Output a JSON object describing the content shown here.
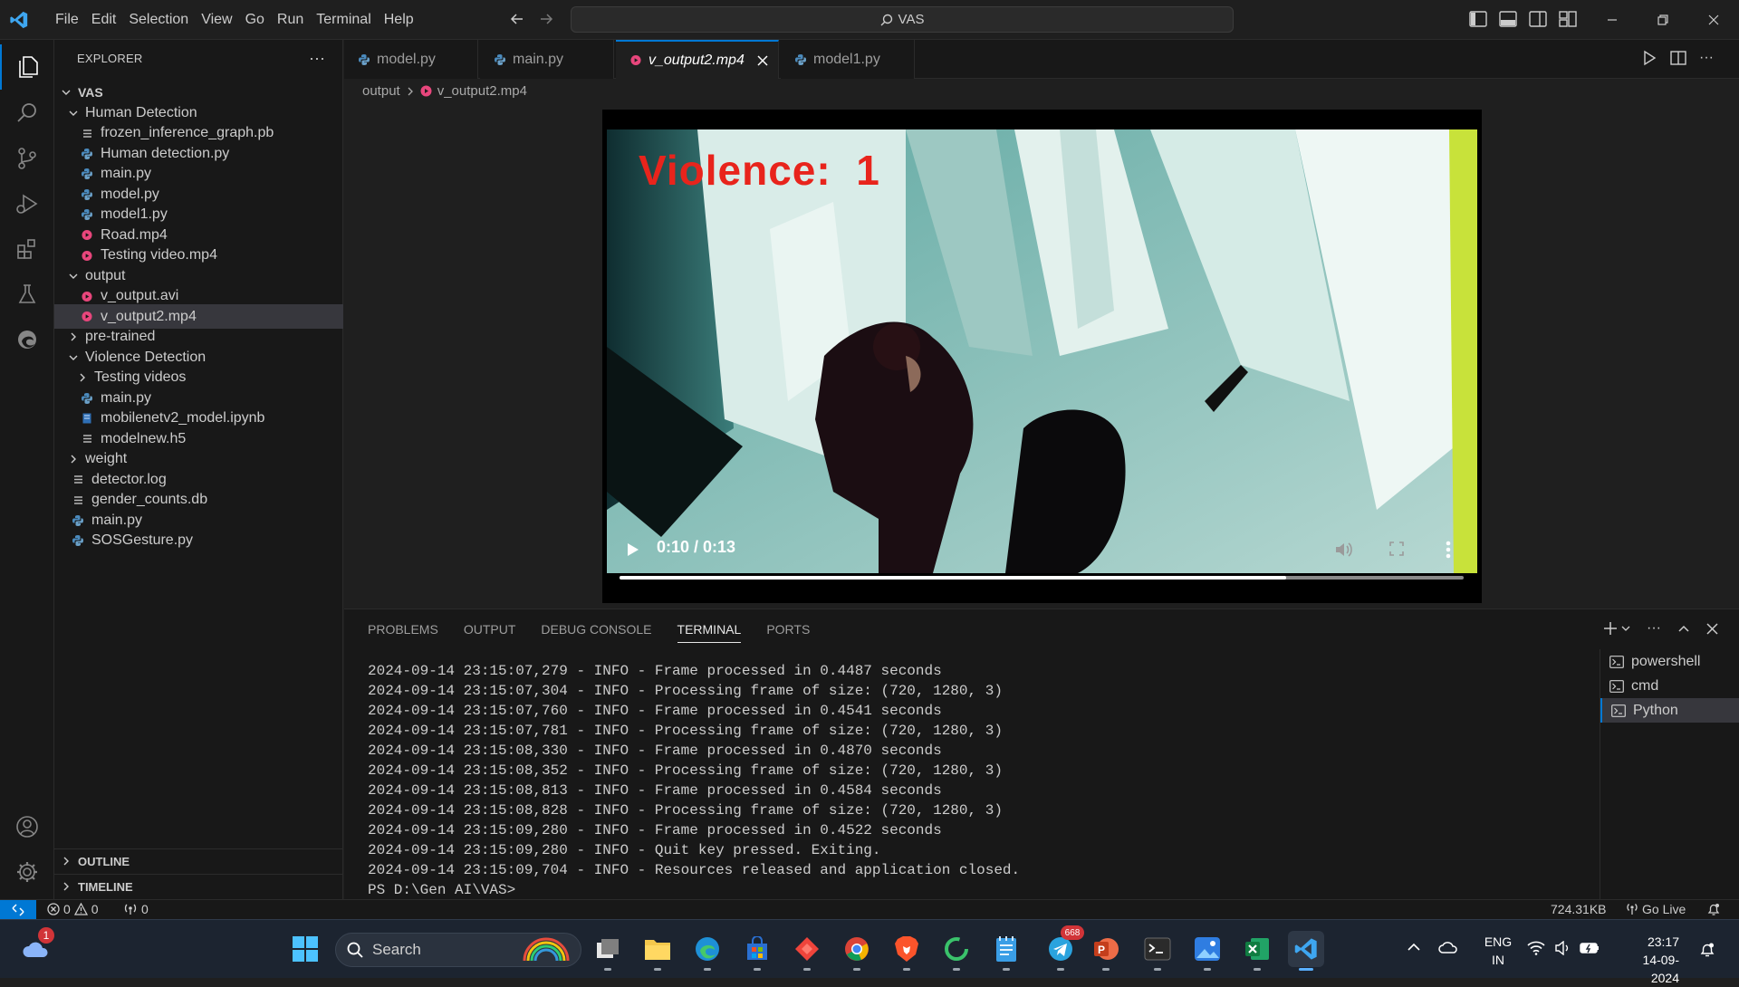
{
  "window": {
    "search_text": "VAS"
  },
  "menu": [
    "File",
    "Edit",
    "Selection",
    "View",
    "Go",
    "Run",
    "Terminal",
    "Help"
  ],
  "explorer": {
    "header": "EXPLORER",
    "root": "VAS",
    "items": [
      {
        "label": "Human Detection",
        "depth": 1,
        "type": "folder",
        "open": true
      },
      {
        "label": "frozen_inference_graph.pb",
        "depth": 2,
        "type": "lines"
      },
      {
        "label": "Human detection.py",
        "depth": 2,
        "type": "py"
      },
      {
        "label": "main.py",
        "depth": 2,
        "type": "py"
      },
      {
        "label": "model.py",
        "depth": 2,
        "type": "py"
      },
      {
        "label": "model1.py",
        "depth": 2,
        "type": "py"
      },
      {
        "label": "Road.mp4",
        "depth": 2,
        "type": "media"
      },
      {
        "label": "Testing video.mp4",
        "depth": 2,
        "type": "media"
      },
      {
        "label": "output",
        "depth": 1,
        "type": "folder",
        "open": true
      },
      {
        "label": "v_output.avi",
        "depth": 2,
        "type": "media"
      },
      {
        "label": "v_output2.mp4",
        "depth": 2,
        "type": "media",
        "selected": true
      },
      {
        "label": "pre-trained",
        "depth": 1,
        "type": "folder",
        "open": false
      },
      {
        "label": "Violence Detection",
        "depth": 1,
        "type": "folder",
        "open": true
      },
      {
        "label": "Testing videos",
        "depth": 2,
        "type": "folder",
        "open": false
      },
      {
        "label": "main.py",
        "depth": 2,
        "type": "py"
      },
      {
        "label": "mobilenetv2_model.ipynb",
        "depth": 2,
        "type": "nb"
      },
      {
        "label": "modelnew.h5",
        "depth": 2,
        "type": "lines"
      },
      {
        "label": "weight",
        "depth": 1,
        "type": "folder",
        "open": false
      },
      {
        "label": "detector.log",
        "depth": 1,
        "type": "lines"
      },
      {
        "label": "gender_counts.db",
        "depth": 1,
        "type": "lines"
      },
      {
        "label": "main.py",
        "depth": 1,
        "type": "py"
      },
      {
        "label": "SOSGesture.py",
        "depth": 1,
        "type": "py"
      }
    ],
    "outline": "OUTLINE",
    "timeline": "TIMELINE"
  },
  "tabs": [
    {
      "label": "model.py",
      "type": "py"
    },
    {
      "label": "main.py",
      "type": "py"
    },
    {
      "label": "v_output2.mp4",
      "type": "media",
      "active": true
    },
    {
      "label": "model1.py",
      "type": "py"
    }
  ],
  "breadcrumb": {
    "folder": "output",
    "file": "v_output2.mp4"
  },
  "video": {
    "overlay_text": "Violence:  1",
    "time": "0:10 / 0:13",
    "progress": 0.79
  },
  "panel": {
    "tabs": [
      "PROBLEMS",
      "OUTPUT",
      "DEBUG CONSOLE",
      "TERMINAL",
      "PORTS"
    ],
    "active_tab": "TERMINAL",
    "terminal_lines": [
      "2024-09-14 23:15:07,279 - INFO - Frame processed in 0.4487 seconds",
      "2024-09-14 23:15:07,304 - INFO - Processing frame of size: (720, 1280, 3)",
      "2024-09-14 23:15:07,760 - INFO - Frame processed in 0.4541 seconds",
      "2024-09-14 23:15:07,781 - INFO - Processing frame of size: (720, 1280, 3)",
      "2024-09-14 23:15:08,330 - INFO - Frame processed in 0.4870 seconds",
      "2024-09-14 23:15:08,352 - INFO - Processing frame of size: (720, 1280, 3)",
      "2024-09-14 23:15:08,813 - INFO - Frame processed in 0.4584 seconds",
      "2024-09-14 23:15:08,828 - INFO - Processing frame of size: (720, 1280, 3)",
      "2024-09-14 23:15:09,280 - INFO - Frame processed in 0.4522 seconds",
      "2024-09-14 23:15:09,280 - INFO - Quit key pressed. Exiting.",
      "2024-09-14 23:15:09,704 - INFO - Resources released and application closed.",
      "PS D:\\Gen AI\\VAS> "
    ],
    "terminals": [
      "powershell",
      "cmd",
      "Python"
    ]
  },
  "statusbar": {
    "errors": "0",
    "warnings": "0",
    "ports": "0",
    "size": "724.31KB",
    "golive": "Go Live"
  },
  "taskbar": {
    "search": "Search",
    "weather_badge": "1",
    "telegram_badge": "668",
    "lang1": "ENG",
    "lang2": "IN",
    "time": "23:17",
    "date": "14-09-2024"
  },
  "colors": {
    "accent": "#0078d4",
    "python": "#4b8bbe",
    "media": "#e8467c",
    "violence": "#e8241c"
  }
}
